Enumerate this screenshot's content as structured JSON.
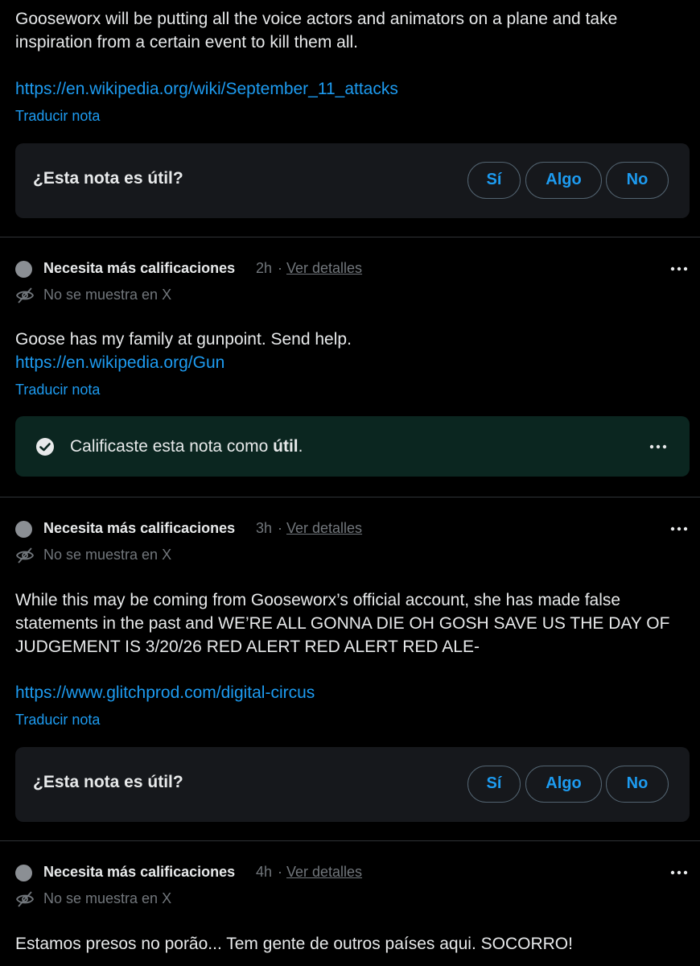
{
  "colors": {
    "background": "#000000",
    "text": "#e7e9ea",
    "muted": "#71767b",
    "link": "#1d9bf0",
    "card": "#16181c",
    "rated_card": "#0b2620",
    "border": "#2f3336"
  },
  "note1": {
    "text": "Gooseworx will be putting all the voice actors and animators on a plane and take\ninspiration from a certain event to kill them all.",
    "link": "https://en.wikipedia.org/wiki/September_11_attacks",
    "translate": "Traducir nota",
    "rating": {
      "question": "¿Esta nota es útil?",
      "yes": "Sí",
      "somewhat": "Algo",
      "no": "No"
    }
  },
  "note2": {
    "status": "Necesita más calificaciones",
    "time": "2h",
    "separator": "·",
    "details": "Ver detalles",
    "more_icon": "more-horizontal-icon",
    "hidden_icon": "eye-slash-icon",
    "hidden_label": "No se muestra en X",
    "text": "Goose has my family at gunpoint. Send help.",
    "link": "https://en.wikipedia.org/Gun",
    "translate": "Traducir nota",
    "rated": {
      "check_icon": "check-circle-icon",
      "prefix": "Calificaste esta nota como ",
      "value": "útil",
      "suffix": "."
    }
  },
  "note3": {
    "status": "Necesita más calificaciones",
    "time": "3h",
    "separator": "·",
    "details": "Ver detalles",
    "hidden_label": "No se muestra en X",
    "text": "While this may be coming from Gooseworx’s official account, she has made false\nstatements in the past and WE’RE ALL GONNA DIE OH GOSH SAVE US THE DAY OF\nJUDGEMENT IS 3/20/26 RED ALERT RED ALERT RED ALE-",
    "link": "https://www.glitchprod.com/digital-circus",
    "translate": "Traducir nota",
    "rating": {
      "question": "¿Esta nota es útil?",
      "yes": "Sí",
      "somewhat": "Algo",
      "no": "No"
    }
  },
  "note4": {
    "status": "Necesita más calificaciones",
    "time": "4h",
    "separator": "·",
    "details": "Ver detalles",
    "hidden_label": "No se muestra en X",
    "text": "Estamos presos no porão... Tem gente de outros países aqui. SOCORRO!"
  }
}
